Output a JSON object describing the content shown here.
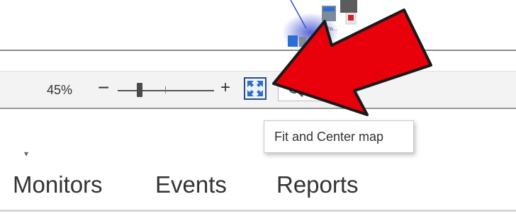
{
  "map": {
    "node_label": "MyFo..."
  },
  "toolbar": {
    "zoom_percent": "45%",
    "zoom_out_label": "−",
    "zoom_in_label": "+",
    "zoom_level_fraction": 0.2
  },
  "tooltip": {
    "text": "Fit and Center map"
  },
  "nav": {
    "dropdown_caret": "▾",
    "tabs": [
      {
        "label": "Monitors"
      },
      {
        "label": "Events"
      },
      {
        "label": "Reports"
      }
    ]
  },
  "colors": {
    "arrow_fill": "#e8000b",
    "fit_button_border": "#2b4d8a",
    "fit_button_icon": "#2f6fc4"
  }
}
